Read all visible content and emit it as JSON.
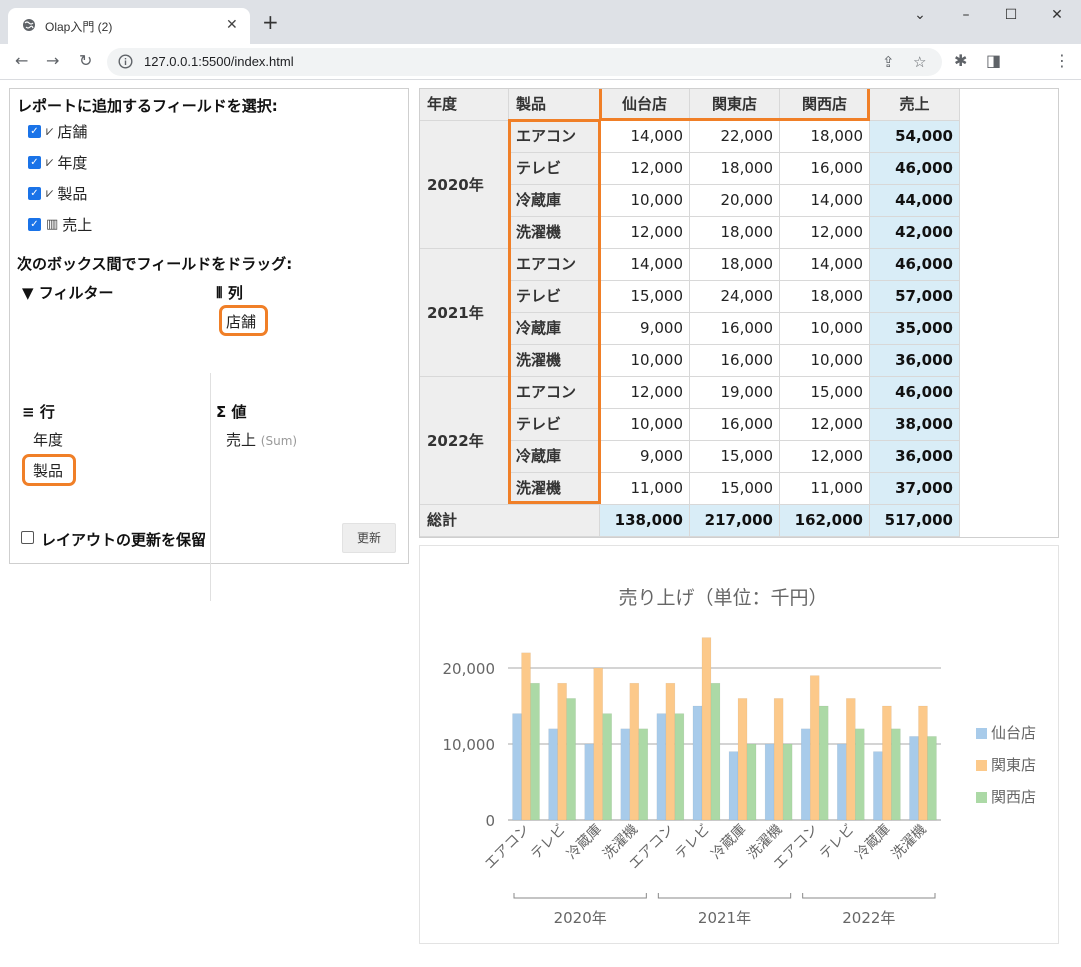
{
  "browser": {
    "tab_title": "Olap入門 (2)",
    "url": "127.0.0.1:5500/index.html"
  },
  "panel": {
    "select_heading": "レポートに追加するフィールドを選択:",
    "fields": [
      {
        "label": "店舗",
        "glyph": "⩗"
      },
      {
        "label": "年度",
        "glyph": "⩗"
      },
      {
        "label": "製品",
        "glyph": "⩗"
      },
      {
        "label": "売上",
        "glyph": "▥"
      }
    ],
    "drag_heading": "次のボックス間でフィールドをドラッグ:",
    "filter_label": "フィルター",
    "columns_label": "列",
    "columns_items": [
      "店舗"
    ],
    "rows_label": "行",
    "rows_items": [
      "年度",
      "製品"
    ],
    "values_label": "値",
    "values_items": [
      {
        "label": "売上",
        "agg": "(Sum)"
      }
    ],
    "defer_label": "レイアウトの更新を保留",
    "update_button": "更新"
  },
  "grid": {
    "headers": {
      "year": "年度",
      "product": "製品",
      "stores": [
        "仙台店",
        "関東店",
        "関西店"
      ],
      "total": "売上"
    },
    "groups": [
      {
        "year": "2020年",
        "rows": [
          {
            "product": "エアコン",
            "values": [
              "14,000",
              "22,000",
              "18,000"
            ],
            "total": "54,000"
          },
          {
            "product": "テレビ",
            "values": [
              "12,000",
              "18,000",
              "16,000"
            ],
            "total": "46,000"
          },
          {
            "product": "冷蔵庫",
            "values": [
              "10,000",
              "20,000",
              "14,000"
            ],
            "total": "44,000"
          },
          {
            "product": "洗濯機",
            "values": [
              "12,000",
              "18,000",
              "12,000"
            ],
            "total": "42,000"
          }
        ]
      },
      {
        "year": "2021年",
        "rows": [
          {
            "product": "エアコン",
            "values": [
              "14,000",
              "18,000",
              "14,000"
            ],
            "total": "46,000"
          },
          {
            "product": "テレビ",
            "values": [
              "15,000",
              "24,000",
              "18,000"
            ],
            "total": "57,000"
          },
          {
            "product": "冷蔵庫",
            "values": [
              "9,000",
              "16,000",
              "10,000"
            ],
            "total": "35,000"
          },
          {
            "product": "洗濯機",
            "values": [
              "10,000",
              "16,000",
              "10,000"
            ],
            "total": "36,000"
          }
        ]
      },
      {
        "year": "2022年",
        "rows": [
          {
            "product": "エアコン",
            "values": [
              "12,000",
              "19,000",
              "15,000"
            ],
            "total": "46,000"
          },
          {
            "product": "テレビ",
            "values": [
              "10,000",
              "16,000",
              "12,000"
            ],
            "total": "38,000"
          },
          {
            "product": "冷蔵庫",
            "values": [
              "9,000",
              "15,000",
              "12,000"
            ],
            "total": "36,000"
          },
          {
            "product": "洗濯機",
            "values": [
              "11,000",
              "15,000",
              "11,000"
            ],
            "total": "37,000"
          }
        ]
      }
    ],
    "grand_total": {
      "label": "総計",
      "values": [
        "138,000",
        "217,000",
        "162,000"
      ],
      "total": "517,000"
    }
  },
  "chart_data": {
    "type": "bar",
    "title": "売り上げ（単位：千円）",
    "categories": [
      "エアコン",
      "テレビ",
      "冷蔵庫",
      "洗濯機",
      "エアコン",
      "テレビ",
      "冷蔵庫",
      "洗濯機",
      "エアコン",
      "テレビ",
      "冷蔵庫",
      "洗濯機"
    ],
    "groups": [
      {
        "label": "2020年",
        "start": 0,
        "end": 3
      },
      {
        "label": "2021年",
        "start": 4,
        "end": 7
      },
      {
        "label": "2022年",
        "start": 8,
        "end": 11
      }
    ],
    "series": [
      {
        "name": "仙台店",
        "color": "#a8cbea",
        "values": [
          14000,
          12000,
          10000,
          12000,
          14000,
          15000,
          9000,
          10000,
          12000,
          10000,
          9000,
          11000
        ]
      },
      {
        "name": "関東店",
        "color": "#fcc98a",
        "values": [
          22000,
          18000,
          20000,
          18000,
          18000,
          24000,
          16000,
          16000,
          19000,
          16000,
          15000,
          15000
        ]
      },
      {
        "name": "関西店",
        "color": "#acd9a6",
        "values": [
          18000,
          16000,
          14000,
          12000,
          14000,
          18000,
          10000,
          10000,
          15000,
          12000,
          12000,
          11000
        ]
      }
    ],
    "yticks": [
      0,
      10000,
      20000
    ],
    "ytick_labels": [
      "0",
      "10,000",
      "20,000"
    ],
    "ylim": [
      0,
      24000
    ],
    "legend": "right"
  },
  "colors": {
    "highlight": "#f07f27",
    "total_bg": "#d9edf7",
    "header_bg": "#eeeeee"
  }
}
